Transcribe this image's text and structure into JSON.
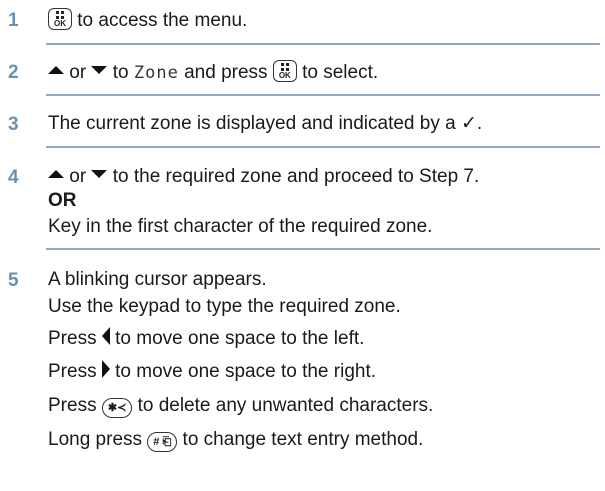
{
  "steps": [
    {
      "number": "1",
      "after_key": " to access the menu."
    },
    {
      "number": "2",
      "or": " or ",
      "to": " to ",
      "menu_item": "Zone",
      "and_press": " and press ",
      "to_select": " to select."
    },
    {
      "number": "3",
      "text": "The current zone is displayed and indicated by a ✓."
    },
    {
      "number": "4",
      "or": " or ",
      "line1_rest": " to the required zone and proceed to Step 7.",
      "or_label": "OR",
      "line3": "Key in the first character of the required zone."
    },
    {
      "number": "5",
      "line1": "A blinking cursor appears.",
      "line2": "Use the keypad to type the required zone.",
      "press": "Press ",
      "left_rest": " to move one space to the left.",
      "right_rest": " to move one space to the right.",
      "delete_rest": " to delete any unwanted characters.",
      "long_press": "Long press ",
      "method_rest": " to change text entry method."
    }
  ],
  "keys": {
    "ok_label": "OK",
    "star_label": "✱≺",
    "hash_label": "# ⎗"
  },
  "colors": {
    "step_number": "#6d8fb0",
    "divider": "#8ea9c4",
    "text": "#1a1a1a"
  },
  "icons": {
    "menu_ok_key": "menu-ok-key-icon",
    "up": "up-arrow-icon",
    "down": "down-arrow-icon",
    "left": "left-arrow-icon",
    "right": "right-arrow-icon",
    "star_key": "star-delete-key-icon",
    "hash_key": "hash-key-icon"
  }
}
